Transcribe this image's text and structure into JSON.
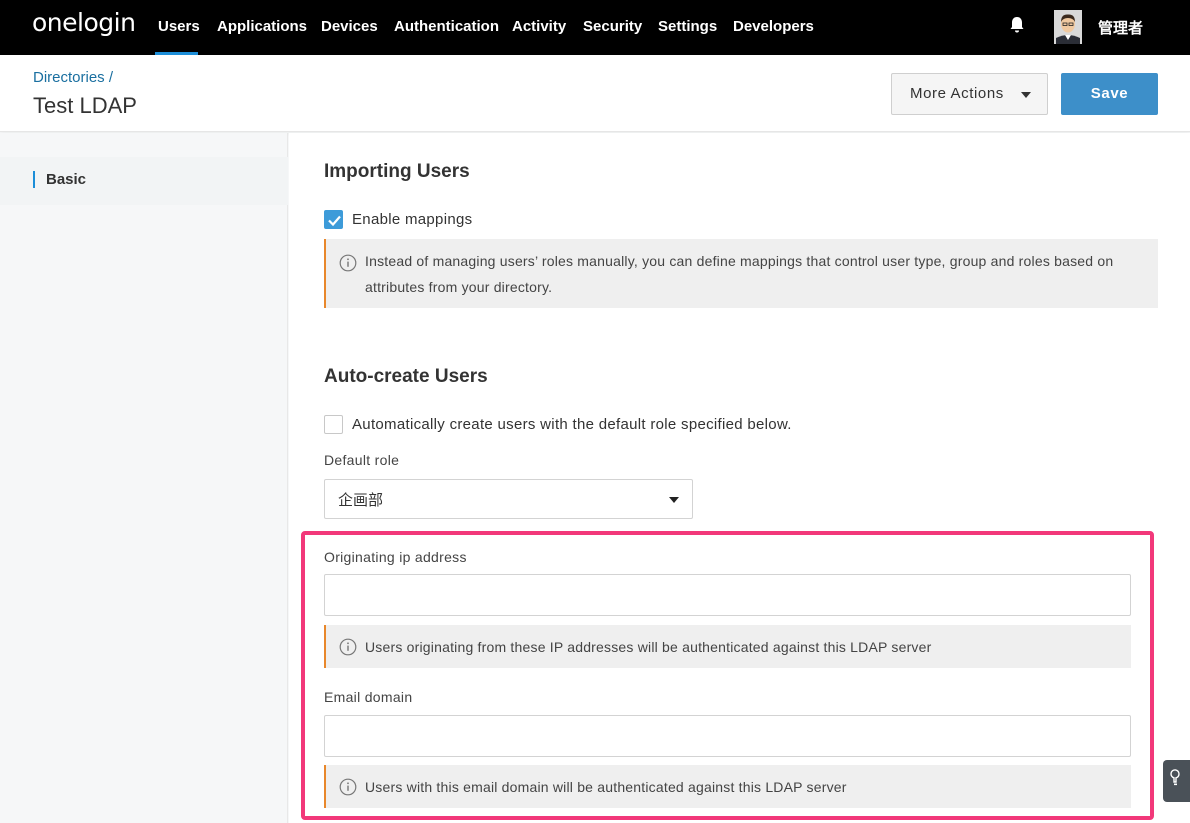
{
  "nav": {
    "logo": "onelogin",
    "items": [
      "Users",
      "Applications",
      "Devices",
      "Authentication",
      "Activity",
      "Security",
      "Settings",
      "Developers"
    ],
    "active": "Users",
    "user_name": "管理者",
    "accent_color": "#1c8ed8"
  },
  "header": {
    "breadcrumb": "Directories /",
    "title": "Test LDAP",
    "more_actions_label": "More Actions",
    "save_label": "Save"
  },
  "sidebar": {
    "items": [
      {
        "label": "Basic",
        "active": true
      }
    ]
  },
  "importing": {
    "title": "Importing Users",
    "enable_mappings_label": "Enable mappings",
    "enable_mappings_checked": true,
    "info_line1": "Instead of managing users’ roles manually, you can define mappings that control user type, group and roles based on",
    "info_line2": "attributes from your directory."
  },
  "autocreate": {
    "title": "Auto-create Users",
    "auto_create_label": "Automatically create users with the default role specified below.",
    "auto_create_checked": false,
    "default_role_label": "Default role",
    "default_role_value": "企画部"
  },
  "highlight": {
    "ip_label": "Originating ip address",
    "ip_value": "",
    "ip_info": "Users originating from these IP addresses will be authenticated against this LDAP server",
    "email_label": "Email domain",
    "email_value": "",
    "email_info": "Users with this email domain will be authenticated against this LDAP server",
    "highlight_color": "#f2387a"
  },
  "colors": {
    "primary_button": "#3d8fc9",
    "info_border": "#e8872b",
    "checkbox_checked": "#3d9bd9"
  }
}
